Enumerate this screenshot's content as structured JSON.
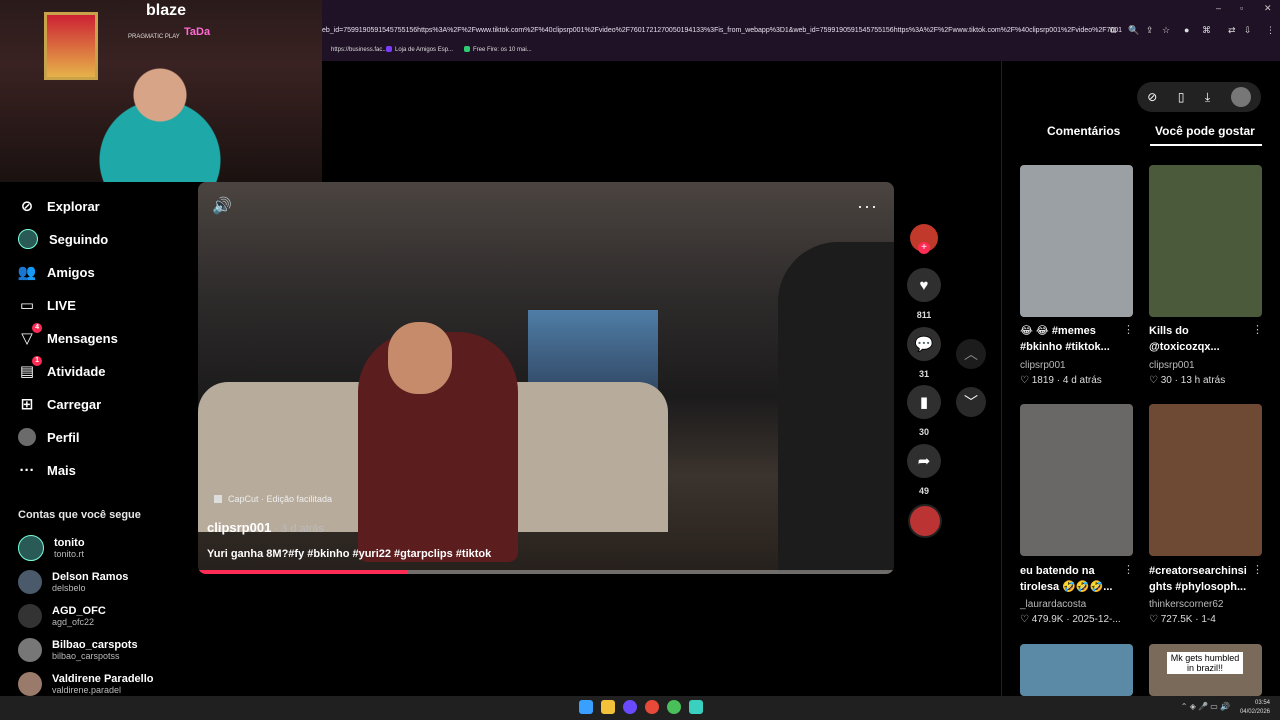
{
  "webcam": {
    "brand": "blaze",
    "brand_sub": "PRAGMATIC PLAY",
    "tada": "TaDa"
  },
  "browser": {
    "address": "eb_id=7599190591545755156https%3A%2F%2Fwww.tiktok.com%2F%40clipsrp001%2Fvideo%2F7601721270050194133%3Fis_from_webapp%3D1&web_id=7599190591545755156https%3A%2F%2Fwww.tiktok.com%2F%40clipsrp001%2Fvideo%2F76017...",
    "bookmarks": [
      {
        "label": "https://business.fac...",
        "color": "#888888"
      },
      {
        "label": "Loja de Amigos Esp...",
        "color": "#7a3cff"
      },
      {
        "label": "Free Fire: os 10 mai...",
        "color": "#2ecc71"
      }
    ]
  },
  "nav": {
    "items": [
      {
        "label": "Explorar",
        "icon": "compass-icon"
      },
      {
        "label": "Seguindo",
        "icon": "avatar-icon"
      },
      {
        "label": "Amigos",
        "icon": "friends-icon"
      },
      {
        "label": "LIVE",
        "icon": "live-icon"
      },
      {
        "label": "Mensagens",
        "icon": "messages-icon",
        "badge": "4"
      },
      {
        "label": "Atividade",
        "icon": "activity-icon",
        "badge": "1"
      },
      {
        "label": "Carregar",
        "icon": "upload-icon"
      },
      {
        "label": "Perfil",
        "icon": "profile-icon"
      },
      {
        "label": "Mais",
        "icon": "more-icon"
      }
    ],
    "following_header": "Contas que você segue",
    "following": [
      {
        "name": "tonito",
        "handle": "tonito.rt"
      },
      {
        "name": "Delson Ramos",
        "handle": "delsbelo"
      },
      {
        "name": "AGD_OFC",
        "handle": "agd_ofc22"
      },
      {
        "name": "Bilbao_carspots",
        "handle": "bilbao_carspotss"
      },
      {
        "name": "Valdirene Paradello",
        "handle": "valdirene.paradel"
      }
    ]
  },
  "video": {
    "capcut": "CapCut · Edição facilitada",
    "author": "clipsrp001",
    "time": " · 3 d atrás",
    "caption": "Yuri ganha 8M?#fy #bkinho #yuri22 #gtarpclips #tiktok",
    "progress": 0.3
  },
  "actions": {
    "likes": "811",
    "comments": "31",
    "saves": "30",
    "shares": "49"
  },
  "side": {
    "tab_comments": "Comentários",
    "tab_like": "Você pode gostar",
    "cards": [
      {
        "title": "😂 😂 #memes #bkinho #tiktok...",
        "author": "clipsrp001",
        "stats": "♡ 1819 · 4 d atrás",
        "bg": "#9aa0a4"
      },
      {
        "title": "Kills do @toxicozqx...",
        "author": "clipsrp001",
        "stats": "♡ 30 · 13 h atrás",
        "bg": "#4a5a3a"
      },
      {
        "title": "eu batendo na tirolesa 🤣🤣🤣...",
        "author": "_laurardacosta",
        "stats": "♡ 479.9K · 2025-12-...",
        "bg": "#6a6866"
      },
      {
        "title": "#creatorsearchinsi ghts #phylosoph...",
        "author": "thinkerscorner62",
        "stats": "♡ 727.5K · 1-4",
        "bg": "#6e4a34"
      },
      {
        "title": "",
        "author": "",
        "stats": "",
        "bg": "#5a8aa6"
      },
      {
        "title": "",
        "author": "",
        "stats": "",
        "bg": "#7a6a5a",
        "overlay": "Mk gets humbled in brazil!!"
      }
    ]
  },
  "taskbar": {
    "time": "03:54",
    "date": "04/02/2026"
  }
}
